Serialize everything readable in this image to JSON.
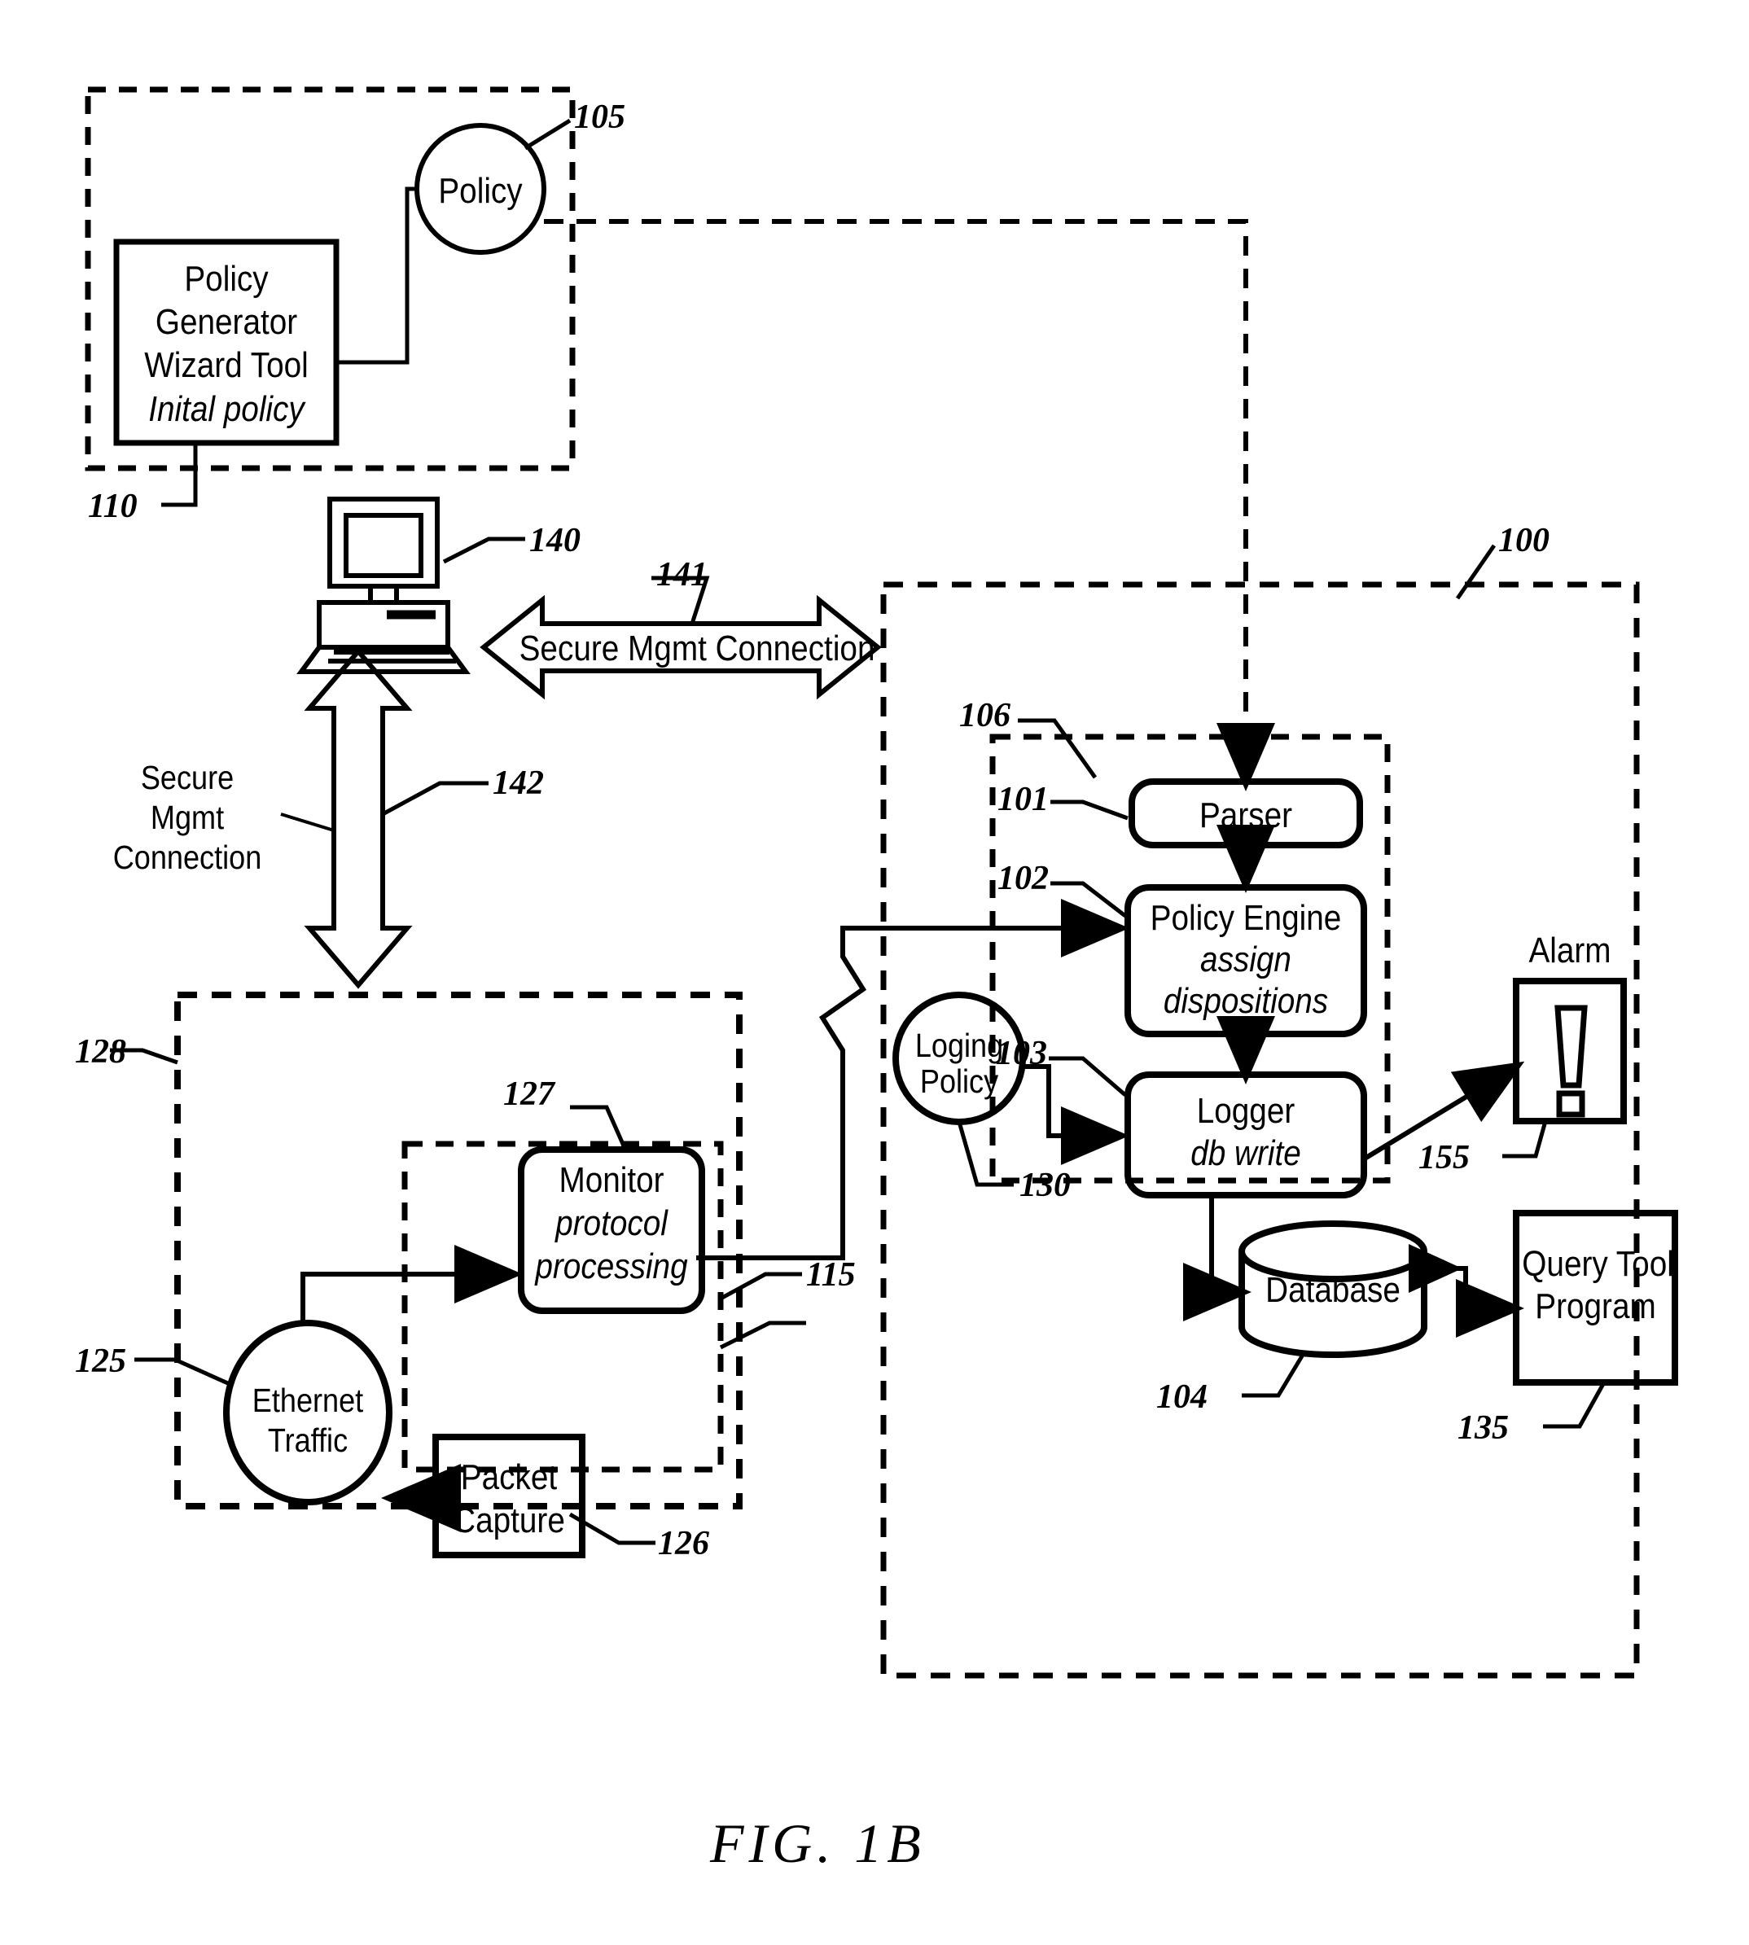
{
  "figure": {
    "caption": "FIG. 1B",
    "domain_note": "patent line drawing"
  },
  "nodes": {
    "policy_circle": {
      "label": "Policy",
      "ref": "105"
    },
    "policy_generator": {
      "line1": "Policy",
      "line2": "Generator",
      "line3": "Wizard Tool",
      "line4_italic": "Inital policy",
      "ref": "110"
    },
    "workstation": {
      "ref": "140",
      "icon": "computer-icon"
    },
    "secure_conn_horizontal": {
      "label": "Secure Mgmt Connection",
      "ref": "141"
    },
    "secure_conn_vertical": {
      "line1": "Secure",
      "line2": "Mgmt",
      "line3": "Connection",
      "ref": "142"
    },
    "system_boundary": {
      "ref": "100"
    },
    "engine_group": {
      "ref": "106"
    },
    "parser": {
      "label": "Parser",
      "ref": "101"
    },
    "policy_engine": {
      "line1": "Policy Engine",
      "line2_italic": "assign",
      "line3_italic": "dispositions",
      "ref": "102"
    },
    "logger": {
      "line1": "Logger",
      "line2_italic": "db write",
      "ref": "103"
    },
    "loging_policy": {
      "line1": "Loging",
      "line2": "Policy",
      "ref": "130"
    },
    "alarm": {
      "label": "Alarm",
      "glyph": "!",
      "ref": "155"
    },
    "database": {
      "label": "Database",
      "ref": "104"
    },
    "query_tool": {
      "line1": "Query Tool",
      "line2": "Program",
      "ref": "135"
    },
    "sensor_boundary": {
      "ref": "128"
    },
    "monitor_group": {
      "ref": "115"
    },
    "monitor": {
      "line1": "Monitor",
      "line2_italic": "protocol",
      "line3_italic": "processing",
      "ref": "127"
    },
    "packet_capture": {
      "line1": "Packet",
      "line2": "Capture",
      "ref": "126"
    },
    "ethernet_traffic": {
      "line1": "Ethernet",
      "line2": "Traffic",
      "ref": "125"
    }
  },
  "colors": {
    "ink": "#000000",
    "paper": "#ffffff"
  }
}
